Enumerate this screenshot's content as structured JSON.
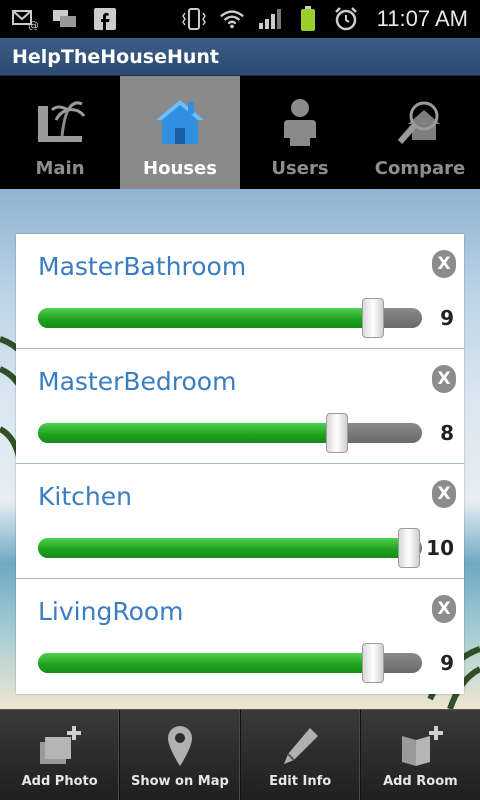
{
  "status_bar": {
    "time": "11:07 AM",
    "left_icons": [
      "email-notification-icon",
      "chat-notification-icon",
      "facebook-icon"
    ],
    "right_icons": [
      "vibrate-icon",
      "wifi-icon",
      "signal-icon",
      "battery-icon",
      "alarm-icon"
    ],
    "battery_color": "#9ccd2e"
  },
  "app": {
    "title": "HelpTheHouseHunt"
  },
  "tabs": [
    {
      "label": "Main",
      "icon": "beach-icon",
      "active": false
    },
    {
      "label": "Houses",
      "icon": "house-icon",
      "active": true
    },
    {
      "label": "Users",
      "icon": "user-icon",
      "active": false
    },
    {
      "label": "Compare",
      "icon": "compare-icon",
      "active": false
    }
  ],
  "rooms": [
    {
      "name": "MasterBathroom",
      "value": "9",
      "level": 0.9,
      "close": "X"
    },
    {
      "name": "MasterBedroom",
      "value": "8",
      "level": 0.8,
      "close": "X"
    },
    {
      "name": "Kitchen",
      "value": "10",
      "level": 1.0,
      "close": "X"
    },
    {
      "name": "LivingRoom",
      "value": "9",
      "level": 0.9,
      "close": "X"
    }
  ],
  "toolbar": [
    {
      "label": "Add Photo",
      "icon": "add-photo-icon"
    },
    {
      "label": "Show on Map",
      "icon": "map-pin-icon"
    },
    {
      "label": "Edit Info",
      "icon": "pencil-icon"
    },
    {
      "label": "Add Room",
      "icon": "add-room-icon"
    }
  ],
  "colors": {
    "accent_blue": "#3a7dc2",
    "slider_green": "#1ea21e",
    "active_tab": "#8a8a8a",
    "title_bar": "#2c4a70"
  }
}
